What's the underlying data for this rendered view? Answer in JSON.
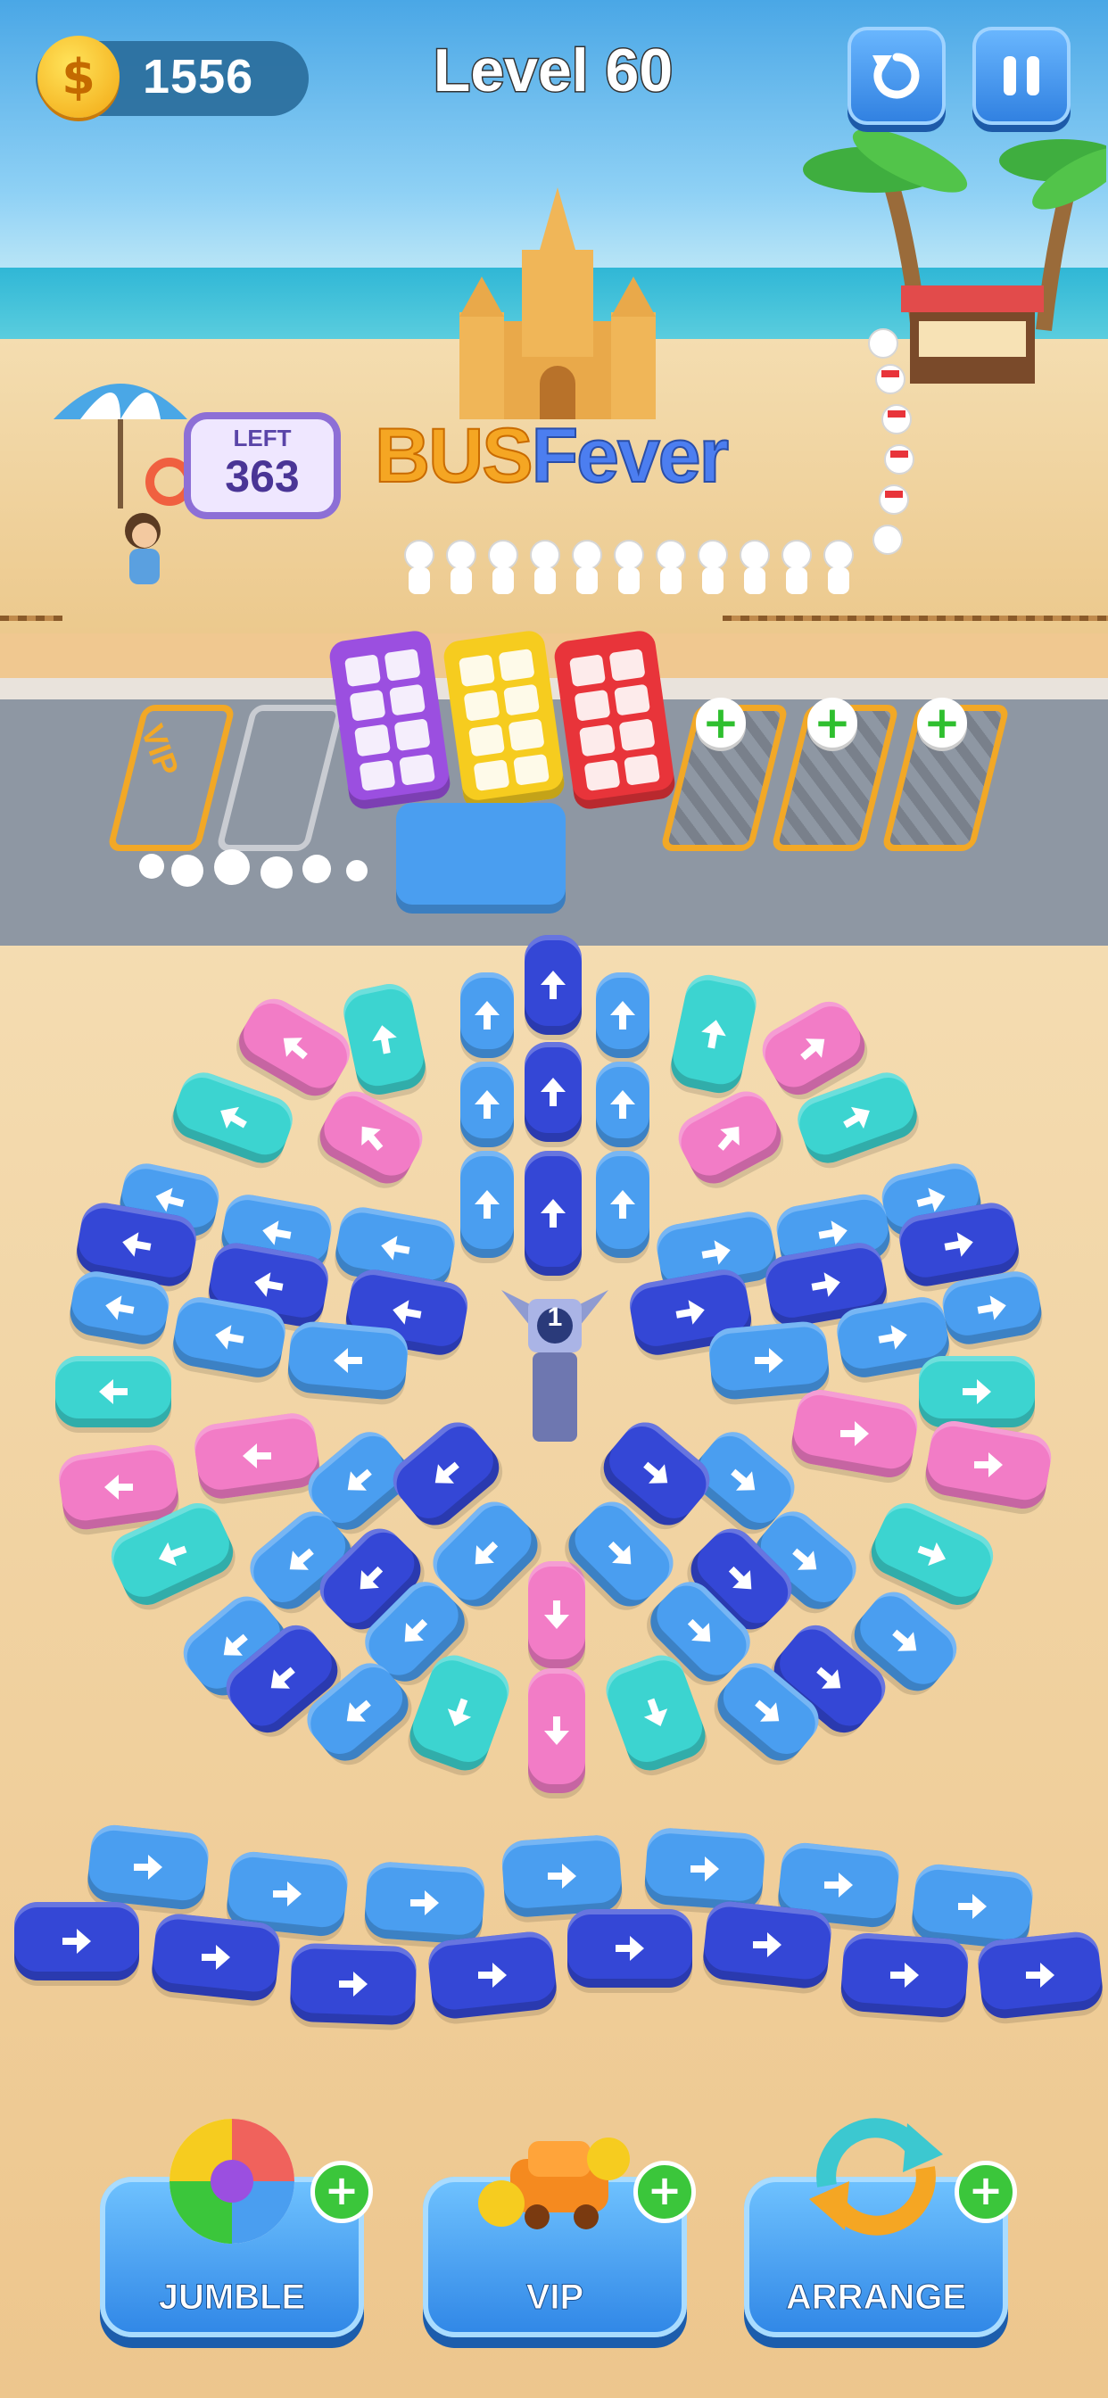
{
  "hud": {
    "coins": "1556",
    "coin_symbol": "$",
    "level": "Level 60",
    "restart_icon": "restart-icon",
    "pause_icon": "pause-icon"
  },
  "scene": {
    "left_sign": {
      "label": "LEFT",
      "count": "363"
    },
    "logo": {
      "part1": "BUS",
      "part2": "Fever"
    }
  },
  "parking": {
    "vip_label": "VIP",
    "slots": [
      "vip",
      "empty",
      "purple-bus",
      "yellow-bus",
      "red-bus",
      "locked",
      "locked",
      "locked"
    ]
  },
  "center_icon": {
    "label": "1"
  },
  "boosters": [
    {
      "label": "JUMBLE",
      "icon": "ball-icon"
    },
    {
      "label": "VIP",
      "icon": "car-icon"
    },
    {
      "label": "ARRANGE",
      "icon": "arrange-icon"
    }
  ],
  "colors": {
    "blue": "#4a9ef0",
    "dark_blue": "#3447d6",
    "cyan": "#3cd4d0",
    "pink": "#f27cc6",
    "purple": "#9b4fe0",
    "yellow": "#f6cc1f",
    "red": "#e8343a"
  }
}
